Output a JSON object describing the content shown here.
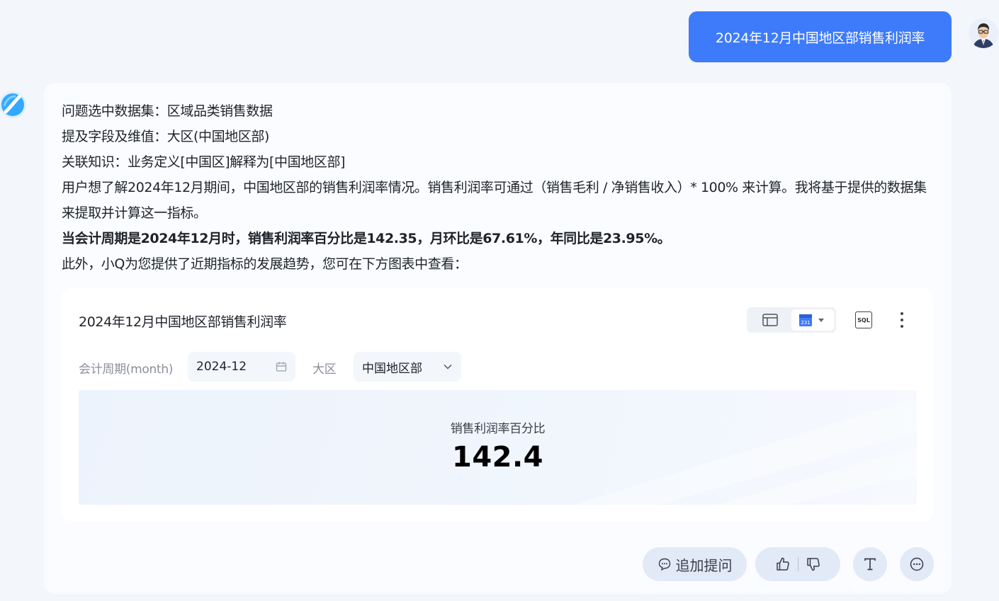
{
  "user_message": "2024年12月中国地区部销售利润率",
  "answer": {
    "lines": [
      "问题选中数据集：区域品类销售数据",
      "提及字段及维值：大区(中国地区部)",
      "关联知识：业务定义[中国区]解释为[中国地区部]",
      "用户想了解2024年12月期间，中国地区部的销售利润率情况。销售利润率可通过（销售毛利 / 净销售收入）* 100% 来计算。我将基于提供的数据集来提取并计算这一指标。"
    ],
    "highlight": "当会计周期是2024年12月时，销售利润率百分比是142.35，月环比是67.61%，年同比是23.95%。",
    "closing": "此外，小Q为您提供了近期指标的发展趋势，您可在下方图表中查看："
  },
  "chart": {
    "title": "2024年12月中国地区部销售利润率",
    "calendar_day": "231",
    "sql_label": "SQL",
    "filters": {
      "period_label": "会计周期(month)",
      "period_value": "2024-12",
      "region_label": "大区",
      "region_value": "中国地区部"
    },
    "kpi": {
      "label": "销售利润率百分比",
      "value": "142.4"
    }
  },
  "actions": {
    "followup_label": "追加提问"
  },
  "icons": {
    "user_avatar": "avatar-man-glasses",
    "bot_avatar": "bot-logo-icon",
    "table_view": "table-icon",
    "card_view": "calendar-card-icon",
    "sql": "sql-icon",
    "more": "more-vertical-icon",
    "calendar": "calendar-icon",
    "dropdown": "chevron-down-icon",
    "followup": "chat-bubble-icon",
    "like": "thumbs-up-icon",
    "dislike": "thumbs-down-icon",
    "text": "text-icon",
    "more_actions": "more-horizontal-icon"
  },
  "colors": {
    "accent": "#3e7bfa",
    "page_bg": "#f3f6fb",
    "button_bg": "#e2e9f7"
  }
}
